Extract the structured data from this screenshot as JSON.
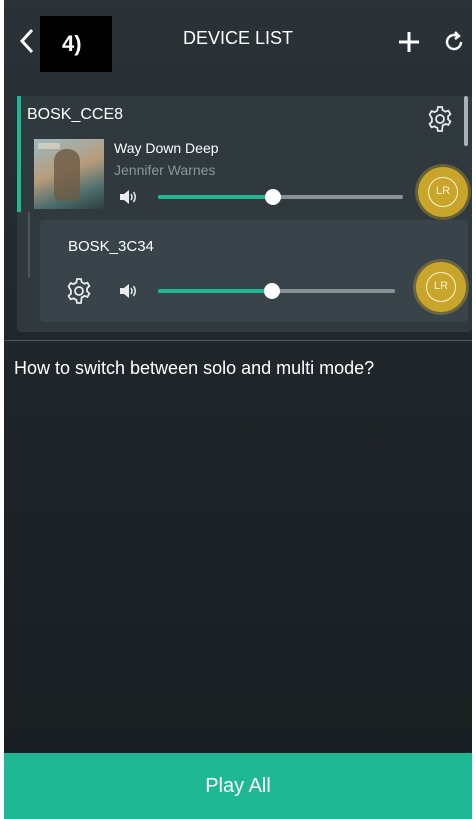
{
  "header": {
    "step_label": "4)",
    "title": "DEVICE LIST",
    "icons": {
      "back": "chevron-left-icon",
      "add": "plus-icon",
      "refresh": "refresh-icon"
    }
  },
  "master_device": {
    "name": "BOSK_CCE8",
    "track": {
      "title": "Way Down Deep",
      "artist": "Jennifer Warnes"
    },
    "volume": 0.47,
    "channel_label": "LR"
  },
  "slave_device": {
    "name": "BOSK_3C34",
    "volume": 0.48,
    "channel_label": "LR"
  },
  "help_text": "How to switch between solo and multi mode?",
  "play_all_label": "Play All",
  "colors": {
    "accent": "#1fb894",
    "channel_button": "#c9a62b",
    "background": "#1d2327"
  }
}
